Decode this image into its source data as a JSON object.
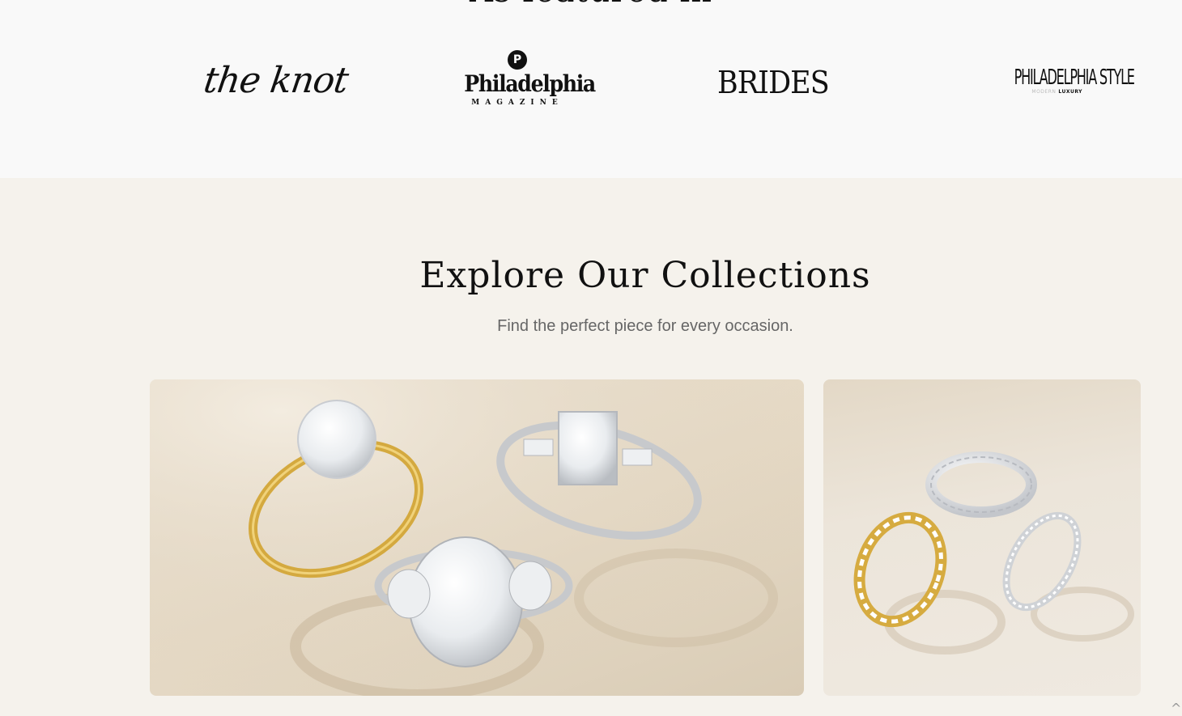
{
  "featured": {
    "heading": "As featured in",
    "logos": {
      "the_knot": "the knot",
      "philadelphia": {
        "badge": "P",
        "name": "Philadelphia",
        "sub": "MAGAZINE"
      },
      "brides": "BRIDES",
      "philadelphia_style": {
        "name": "PHILADELPHIA STYLE",
        "sub_faint": "MODERN",
        "sub": "LUXURY"
      }
    }
  },
  "collections": {
    "title": "Explore Our Collections",
    "subtitle": "Find the perfect piece for every occasion."
  },
  "colors": {
    "featured_bg": "#f9f9f9",
    "section_bg": "#f5f2ec",
    "gold": "#d9b24c",
    "platinum": "#d8d8da"
  },
  "icons": {
    "scroll_top": "chevron-up-icon"
  }
}
